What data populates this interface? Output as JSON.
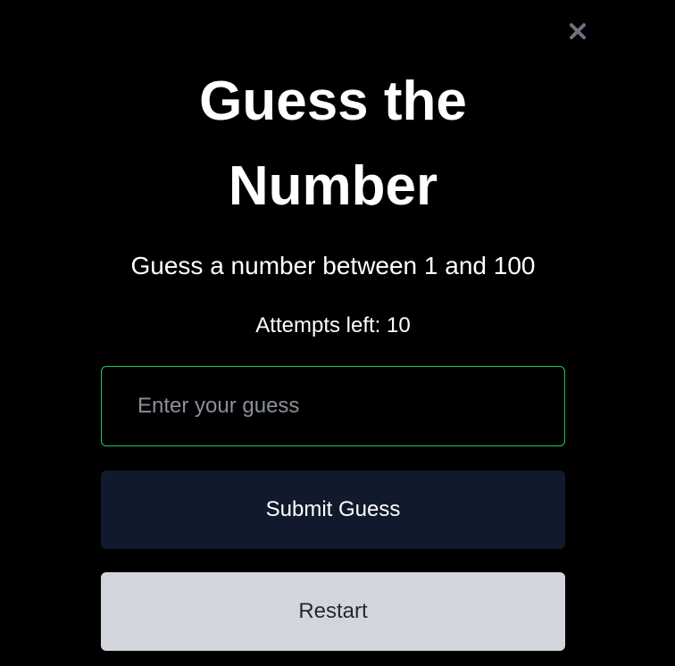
{
  "colors": {
    "background": "#000000",
    "input_border": "#22c55e",
    "submit_bg": "#111a2c",
    "restart_bg": "#d2d6dc",
    "close_icon": "#6b7280"
  },
  "close": {
    "icon": "close-icon"
  },
  "game": {
    "title": "Guess the Number",
    "instruction": "Guess a number between 1 and 100",
    "attempts_label": "Attempts left: 10"
  },
  "input": {
    "value": "",
    "placeholder": "Enter your guess"
  },
  "buttons": {
    "submit_label": "Submit Guess",
    "restart_label": "Restart"
  }
}
